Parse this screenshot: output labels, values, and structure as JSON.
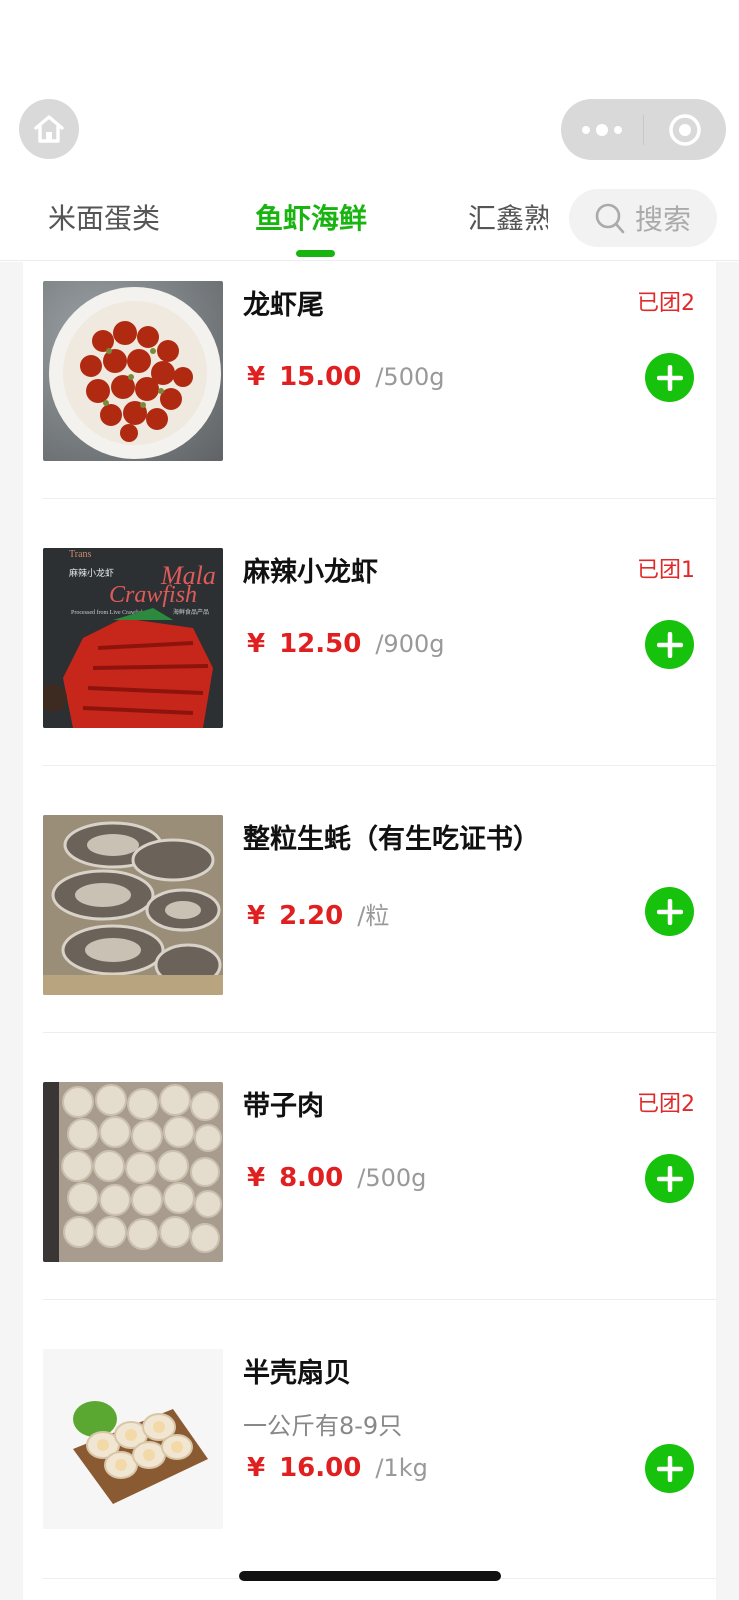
{
  "topbar": {
    "home_icon": "home-icon",
    "more_icon": "more-dots-icon",
    "close_icon": "target-circle-icon"
  },
  "tabs": [
    {
      "label": "米面蛋类",
      "active": false
    },
    {
      "label": "鱼虾海鲜",
      "active": true
    },
    {
      "label": "汇鑫熟",
      "active": false
    }
  ],
  "search": {
    "label": "搜索",
    "icon": "search-icon"
  },
  "colors": {
    "accent": "#18b40f",
    "price": "#e02020",
    "badge": "#e02a2a",
    "add_button": "#17c20c"
  },
  "products": [
    {
      "name": "龙虾尾",
      "badge": "已团2",
      "desc": "",
      "currency": "¥",
      "price": "15.00",
      "unit": "/500g",
      "image": "crayfish-tails-plate"
    },
    {
      "name": "麻辣小龙虾",
      "badge": "已团1",
      "desc": "",
      "currency": "¥",
      "price": "12.50",
      "unit": "/900g",
      "image": "mala-crawfish-package",
      "image_text": {
        "brand": "Trans",
        "cn": "麻辣小龙虾",
        "title1": "Mala",
        "title2": "Crawfish",
        "sub": "Processed from Live Crawfish",
        "tag": "海鲜食品产品"
      }
    },
    {
      "name": "整粒生蚝（有生吃证书）",
      "badge": "",
      "desc": "",
      "currency": "¥",
      "price": "2.20",
      "unit": "/粒",
      "image": "raw-oysters"
    },
    {
      "name": "带子肉",
      "badge": "已团2",
      "desc": "",
      "currency": "¥",
      "price": "8.00",
      "unit": "/500g",
      "image": "scallop-meat-bag"
    },
    {
      "name": "半壳扇贝",
      "badge": "",
      "desc": "一公斤有8-9只",
      "currency": "¥",
      "price": "16.00",
      "unit": "/1kg",
      "image": "half-shell-scallops"
    }
  ]
}
